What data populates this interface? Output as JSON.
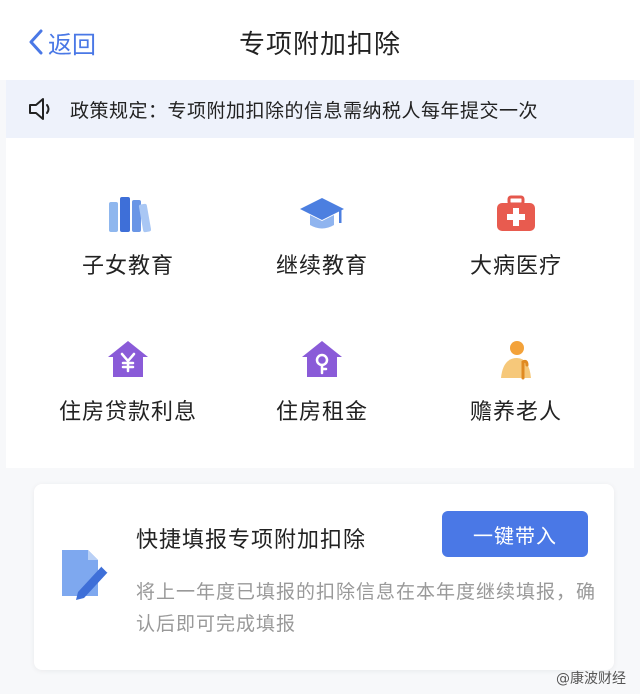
{
  "header": {
    "back_label": "返回",
    "title": "专项附加扣除"
  },
  "notice": {
    "icon": "speaker-icon",
    "text": "政策规定：专项附加扣除的信息需纳税人每年提交一次"
  },
  "categories": [
    {
      "label": "子女教育",
      "icon": "books-icon"
    },
    {
      "label": "继续教育",
      "icon": "graduation-cap-icon"
    },
    {
      "label": "大病医疗",
      "icon": "medical-kit-icon"
    },
    {
      "label": "住房贷款利息",
      "icon": "house-yen-icon"
    },
    {
      "label": "住房租金",
      "icon": "house-key-icon"
    },
    {
      "label": "赡养老人",
      "icon": "elderly-person-icon"
    }
  ],
  "quick_fill": {
    "title": "快捷填报专项附加扣除",
    "description": "将上一年度已填报的扣除信息在本年度继续填报，确认后即可完成填报",
    "button_label": "一键带入",
    "icon": "document-edit-icon"
  },
  "watermark": "@康波财经",
  "colors": {
    "accent": "#4a78e6",
    "notice_bg": "#eef2fb",
    "page_bg": "#f7f8fa"
  }
}
